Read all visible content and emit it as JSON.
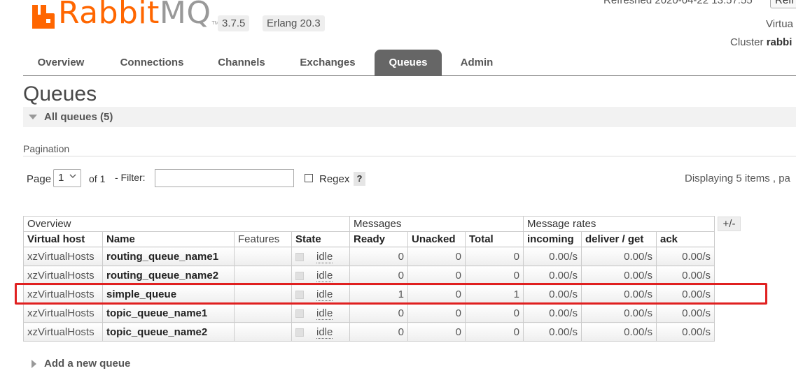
{
  "header": {
    "logo_rabbit": "Rabbit",
    "logo_mq": "MQ",
    "logo_tm": "TM",
    "version": "3.7.5",
    "erlang": "Erlang 20.3",
    "refreshed": "Refreshed 2020-04-22 13:57:55",
    "refresh_button": "Refr",
    "virtual_host_label": "Virtua",
    "cluster_prefix": "Cluster ",
    "cluster_name": "rabbi"
  },
  "nav": {
    "tabs": [
      {
        "label": "Overview"
      },
      {
        "label": "Connections"
      },
      {
        "label": "Channels"
      },
      {
        "label": "Exchanges"
      },
      {
        "label": "Queues",
        "active": true
      },
      {
        "label": "Admin"
      }
    ]
  },
  "page": {
    "title": "Queues",
    "section_title": "All queues (5)",
    "pagination_label": "Pagination",
    "page_label": "Page",
    "page_value": "1",
    "of_label": "of 1",
    "filter_label": "- Filter:",
    "filter_value": "",
    "regex_label": "Regex",
    "help_label": "?",
    "displaying": "Displaying 5 items , pa",
    "plus_minus": "+/-",
    "add_queue": "Add a new queue"
  },
  "table": {
    "groups": [
      "Overview",
      "Messages",
      "Message rates"
    ],
    "columns": [
      "Virtual host",
      "Name",
      "Features",
      "State",
      "Ready",
      "Unacked",
      "Total",
      "incoming",
      "deliver / get",
      "ack"
    ],
    "rows": [
      {
        "vhost": "xzVirtualHosts",
        "name": "routing_queue_name1",
        "features": "",
        "state": "idle",
        "ready": "0",
        "unacked": "0",
        "total": "0",
        "incoming": "0.00/s",
        "deliver_get": "0.00/s",
        "ack": "0.00/s"
      },
      {
        "vhost": "xzVirtualHosts",
        "name": "routing_queue_name2",
        "features": "",
        "state": "idle",
        "ready": "0",
        "unacked": "0",
        "total": "0",
        "incoming": "0.00/s",
        "deliver_get": "0.00/s",
        "ack": "0.00/s"
      },
      {
        "vhost": "xzVirtualHosts",
        "name": "simple_queue",
        "features": "",
        "state": "idle",
        "ready": "1",
        "unacked": "0",
        "total": "1",
        "incoming": "0.00/s",
        "deliver_get": "0.00/s",
        "ack": "0.00/s"
      },
      {
        "vhost": "xzVirtualHosts",
        "name": "topic_queue_name1",
        "features": "",
        "state": "idle",
        "ready": "0",
        "unacked": "0",
        "total": "0",
        "incoming": "0.00/s",
        "deliver_get": "0.00/s",
        "ack": "0.00/s"
      },
      {
        "vhost": "xzVirtualHosts",
        "name": "topic_queue_name2",
        "features": "",
        "state": "idle",
        "ready": "0",
        "unacked": "0",
        "total": "0",
        "incoming": "0.00/s",
        "deliver_get": "0.00/s",
        "ack": "0.00/s"
      }
    ]
  },
  "colors": {
    "brand": "#ff6600",
    "active_tab": "#666666",
    "highlight": "#e02020"
  },
  "icons": {
    "logo": "rabbitmq-logo-icon",
    "section_toggle": "triangle-down-icon",
    "add_toggle": "triangle-right-icon",
    "select_chevron": "chevron-down-icon"
  }
}
